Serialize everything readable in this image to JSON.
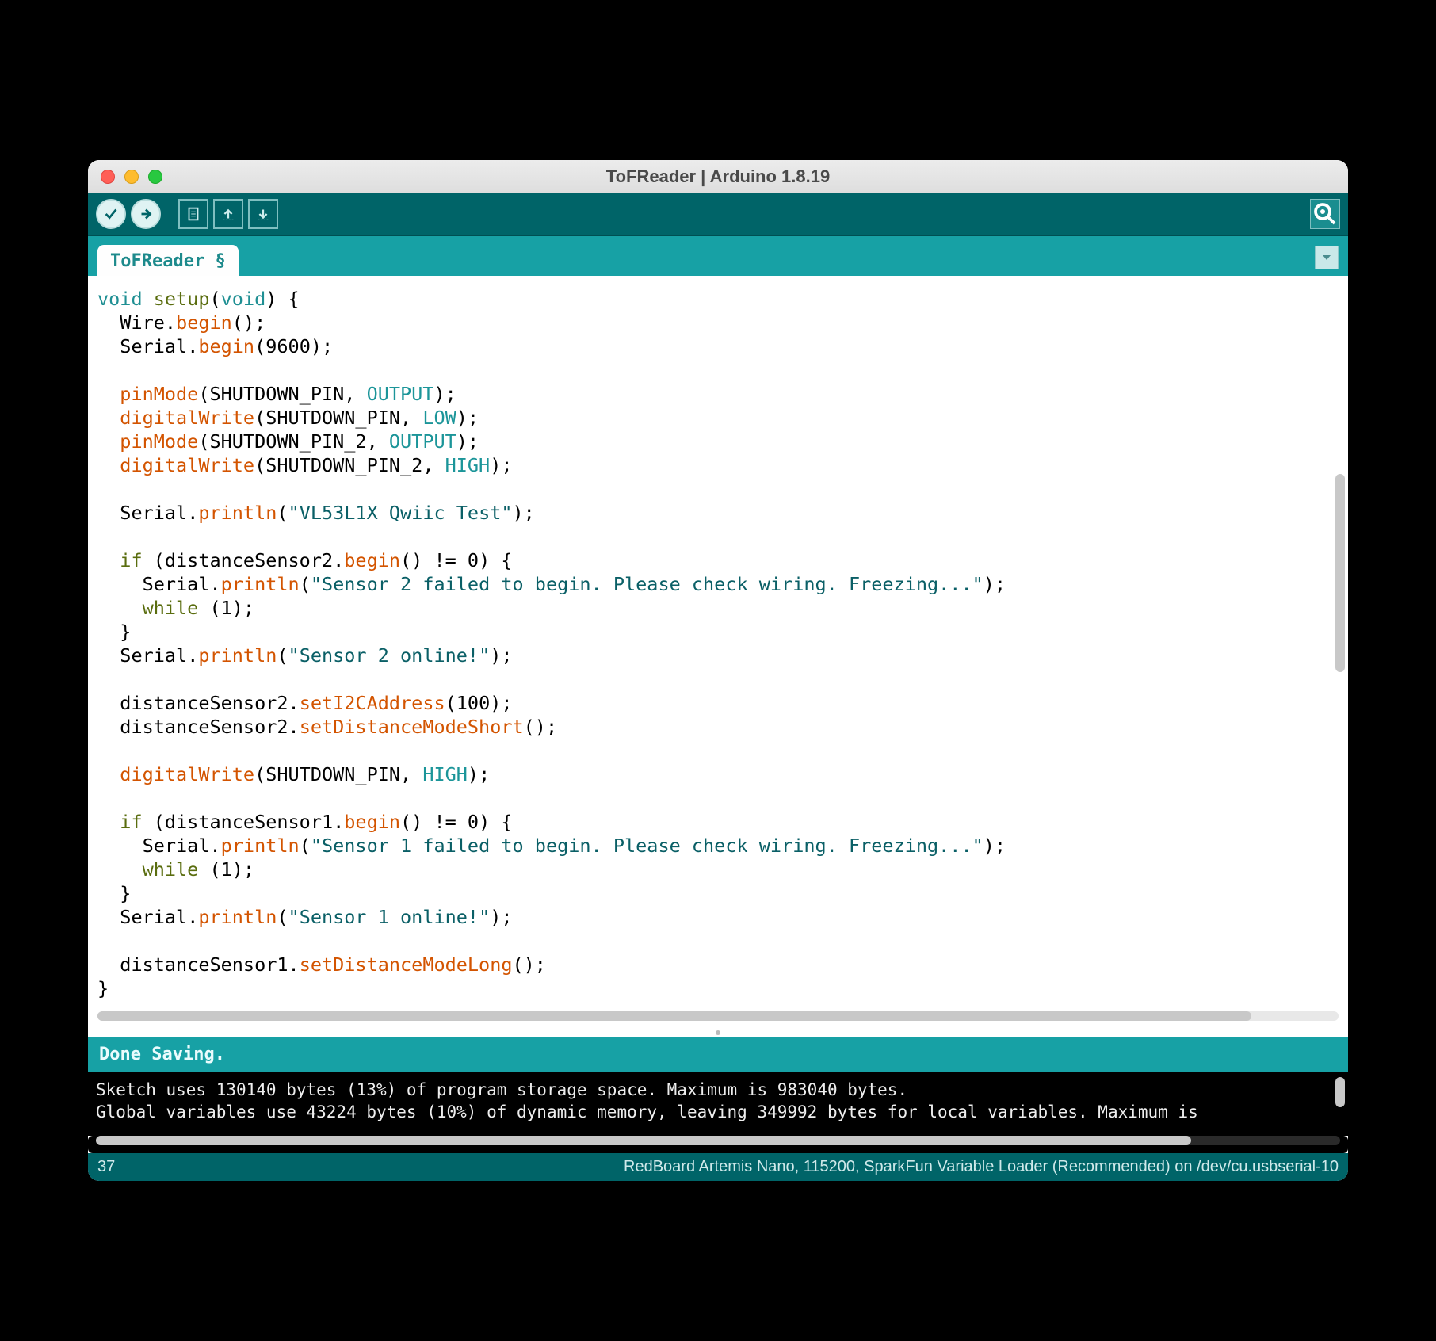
{
  "window": {
    "title": "ToFReader | Arduino 1.8.19"
  },
  "tab": {
    "label": "ToFReader §"
  },
  "status": {
    "text": "Done Saving."
  },
  "console": {
    "line1": "Sketch uses 130140 bytes (13%) of program storage space. Maximum is 983040 bytes.",
    "line2": "Global variables use 43224 bytes (10%) of dynamic memory, leaving 349992 bytes for local variables. Maximum is "
  },
  "footer": {
    "line": "37",
    "board": "RedBoard Artemis Nano, 115200, SparkFun Variable Loader (Recommended) on /dev/cu.usbserial-10"
  },
  "code": {
    "setup_sig_void1": "void",
    "setup_sig_name": "setup",
    "setup_sig_void2": "void",
    "wire": "Wire",
    "begin": "begin",
    "serial": "Serial",
    "baud": "9600",
    "pinMode": "pinMode",
    "shutdown_pin": "SHUTDOWN_PIN",
    "shutdown_pin2": "SHUTDOWN_PIN_2",
    "OUTPUT": "OUTPUT",
    "digitalWrite": "digitalWrite",
    "LOW": "LOW",
    "HIGH": "HIGH",
    "println": "println",
    "str_test": "\"VL53L1X Qwiic Test\"",
    "if": "if",
    "distanceSensor2": "distanceSensor2",
    "distanceSensor1": "distanceSensor1",
    "neq0": " != 0",
    "str_s2fail": "\"Sensor 2 failed to begin. Please check wiring. Freezing...\"",
    "while": "while",
    "one": "1",
    "str_s2online": "\"Sensor 2 online!\"",
    "setI2CAddress": "setI2CAddress",
    "i2c_addr": "100",
    "setDistanceModeShort": "setDistanceModeShort",
    "str_s1fail": "\"Sensor 1 failed to begin. Please check wiring. Freezing...\"",
    "str_s1online": "\"Sensor 1 online!\"",
    "setDistanceModeLong": "setDistanceModeLong"
  }
}
